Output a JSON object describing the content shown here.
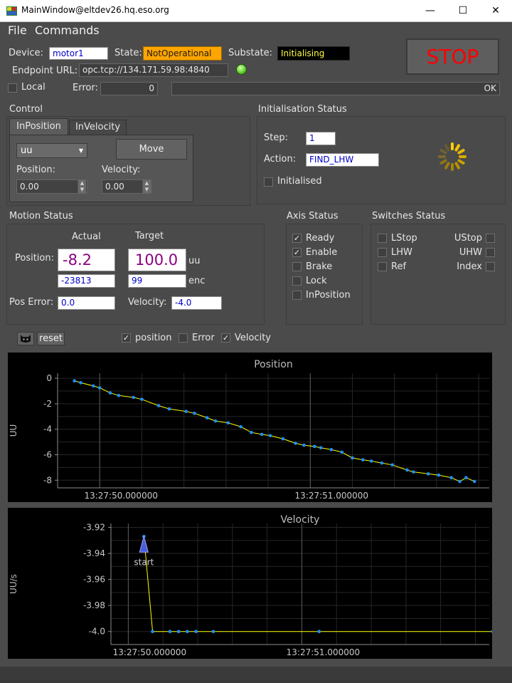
{
  "window": {
    "title": "MainWindow@eltdev26.hq.eso.org"
  },
  "menu": {
    "file": "File",
    "commands": "Commands"
  },
  "status": {
    "device_label": "Device:",
    "device": "motor1",
    "state_label": "State:",
    "state": "NotOperational",
    "substate_label": "Substate:",
    "substate": "Initialising",
    "endpoint_label": "Endpoint URL:",
    "endpoint": "opc.tcp://134.171.59.98:4840",
    "local_label": "Local",
    "error_label": "Error:",
    "error_code": "0",
    "error_text": "OK",
    "stop_label": "STOP",
    "state_color": "#ffa500",
    "stop_color": "#ff0000"
  },
  "control": {
    "title": "Control",
    "tabs": [
      {
        "label": "InPosition"
      },
      {
        "label": "InVelocity"
      }
    ],
    "unit_select": "uu",
    "move_label": "Move",
    "position_label": "Position:",
    "position_value": "0.00",
    "velocity_label": "Velocity:",
    "velocity_value": "0.00"
  },
  "init": {
    "title": "Initialisation Status",
    "step_label": "Step:",
    "step": "1",
    "action_label": "Action:",
    "action": "FIND_LHW",
    "initialised_label": "Initialised"
  },
  "motion": {
    "title": "Motion Status",
    "actual_label": "Actual",
    "target_label": "Target",
    "position_label": "Position:",
    "actual_pos": "-8.2",
    "target_pos": "100.0",
    "uu_label": "uu",
    "actual_enc": "-23813",
    "target_enc": "99",
    "enc_label": "enc",
    "pos_error_label": "Pos Error:",
    "pos_error": "0.0",
    "velocity_label": "Velocity:",
    "velocity": "-4.0"
  },
  "axis": {
    "title": "Axis Status",
    "items": [
      {
        "label": "Ready",
        "checked": true
      },
      {
        "label": "Enable",
        "checked": true
      },
      {
        "label": "Brake",
        "checked": false
      },
      {
        "label": "Lock",
        "checked": false
      },
      {
        "label": "InPosition",
        "checked": false
      }
    ]
  },
  "switches": {
    "title": "Switches Status",
    "left": [
      "LStop",
      "LHW",
      "Ref"
    ],
    "right": [
      "UStop",
      "UHW",
      "Index"
    ]
  },
  "plot_controls": {
    "reset_label": "reset",
    "position_label": "position",
    "position_checked": true,
    "error_label": "Error",
    "error_checked": false,
    "velocity_label": "Velocity",
    "velocity_checked": true
  },
  "chart_data": [
    {
      "type": "line",
      "title": "Position",
      "ylabel": "UU",
      "xlabel": "",
      "x_ticks": [
        "13:27:50.000000",
        "13:27:51.000000"
      ],
      "x_tick_values": [
        0,
        1
      ],
      "y_ticks": [
        "0",
        "-2",
        "-4",
        "-6",
        "-8"
      ],
      "ylim": [
        -8.6,
        0.4
      ],
      "xlim": [
        -0.2,
        1.85
      ],
      "grid": true,
      "series": [
        {
          "color": "#ffff00",
          "marker_color": "#1e90ff",
          "x": [
            -0.12,
            -0.09,
            -0.03,
            0.0,
            0.05,
            0.09,
            0.16,
            0.2,
            0.28,
            0.33,
            0.41,
            0.45,
            0.51,
            0.55,
            0.61,
            0.67,
            0.72,
            0.77,
            0.81,
            0.87,
            0.93,
            0.97,
            1.02,
            1.05,
            1.1,
            1.15,
            1.2,
            1.25,
            1.29,
            1.34,
            1.39,
            1.46,
            1.49,
            1.56,
            1.61,
            1.67,
            1.71,
            1.74,
            1.78
          ],
          "y": [
            -0.2,
            -0.35,
            -0.6,
            -0.75,
            -1.15,
            -1.35,
            -1.5,
            -1.65,
            -2.15,
            -2.4,
            -2.6,
            -2.75,
            -3.1,
            -3.35,
            -3.5,
            -3.8,
            -4.25,
            -4.4,
            -4.5,
            -4.75,
            -5.1,
            -5.25,
            -5.35,
            -5.45,
            -5.6,
            -5.8,
            -6.25,
            -6.4,
            -6.5,
            -6.65,
            -6.8,
            -7.2,
            -7.35,
            -7.5,
            -7.6,
            -7.8,
            -8.1,
            -7.8,
            -8.1
          ]
        }
      ]
    },
    {
      "type": "line",
      "title": "Velocity",
      "ylabel": "UU/s",
      "xlabel": "",
      "x_ticks": [
        "13:27:50.000000",
        "13:27:51.000000"
      ],
      "x_tick_values": [
        0,
        1
      ],
      "y_ticks": [
        "-3.92",
        "-3.94",
        "-3.96",
        "-3.98",
        "-4.0"
      ],
      "y_tick_values": [
        -3.92,
        -3.94,
        -3.96,
        -3.98,
        -4.0
      ],
      "ylim": [
        -4.01,
        -3.917
      ],
      "xlim": [
        -0.1,
        2.08
      ],
      "grid": true,
      "annotations": [
        {
          "text": "start",
          "x": 0.09,
          "y": -3.927
        }
      ],
      "series": [
        {
          "color": "#ffff00",
          "marker_color": "#1e90ff",
          "x": [
            0.09,
            0.14,
            0.24,
            0.29,
            0.34,
            0.39,
            0.49,
            1.1,
            2.1
          ],
          "y": [
            -3.927,
            -4.0,
            -4.0,
            -4.0,
            -4.0,
            -4.0,
            -4.0,
            -4.0,
            -4.0
          ]
        }
      ]
    }
  ]
}
